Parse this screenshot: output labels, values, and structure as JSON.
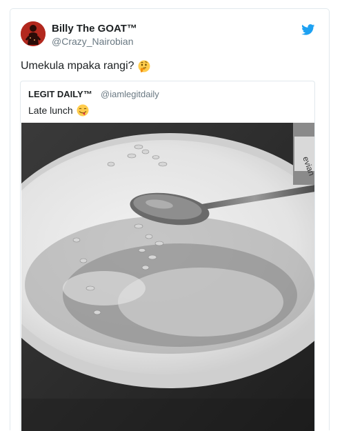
{
  "tweet": {
    "display_name": "Billy The GOAT™",
    "handle": "@Crazy_Nairobian",
    "text": "Umekula mpaka rangi?",
    "emoji": "thinking-face-icon"
  },
  "quoted_tweet": {
    "display_name": "LEGIT DAILY™",
    "handle": "@iamlegitdaily",
    "text": "Late lunch",
    "emoji": "face-savoring-food-icon",
    "photo": {
      "subject": "empty-plate-with-spoon",
      "bottle_label": "evian"
    }
  },
  "colors": {
    "twitter_blue": "#1da1f2",
    "avatar_red": "#b2281e",
    "border": "#e1e8ed",
    "muted_text": "#697882",
    "emoji_yellow": "#ffcc4d"
  },
  "icons": {
    "brand": "twitter-bird-icon"
  }
}
